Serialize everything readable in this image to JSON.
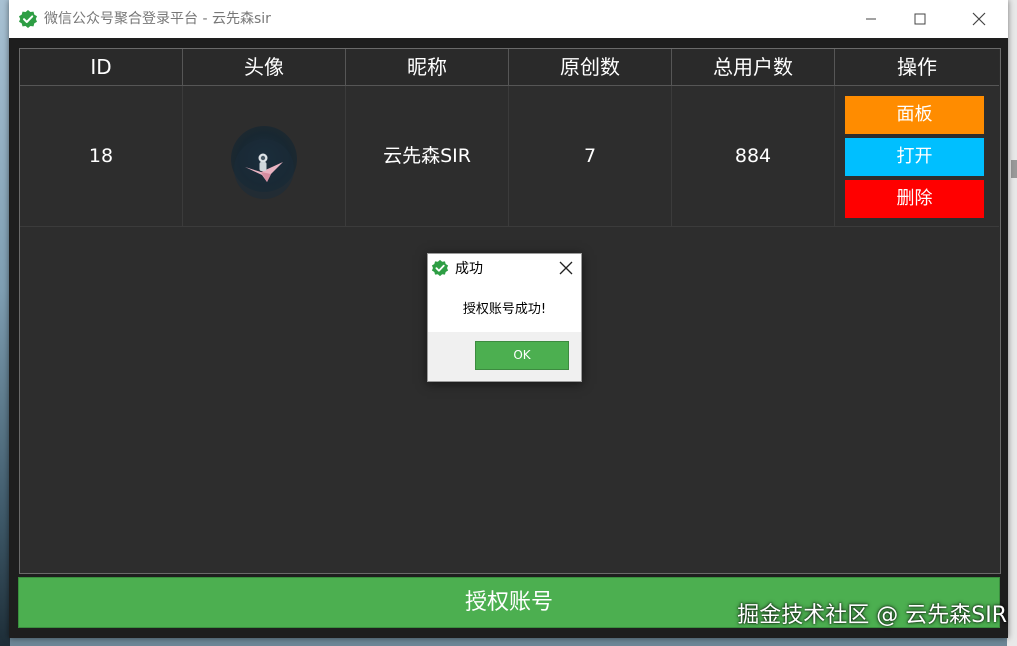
{
  "window": {
    "title": "微信公众号聚合登录平台 - 云先森sir",
    "icon": "green-checkmark-shield-icon"
  },
  "table": {
    "headers": [
      "ID",
      "头像",
      "昵称",
      "原创数",
      "总用户数",
      "操作"
    ],
    "rows": [
      {
        "id": "18",
        "avatar": "astronaut-on-paper-crane-avatar",
        "nickname": "云先森SIR",
        "original_count": "7",
        "total_users": "884"
      }
    ],
    "actions": {
      "panel": "面板",
      "open": "打开",
      "delete": "删除"
    }
  },
  "authorize_button": "授权账号",
  "dialog": {
    "title": "成功",
    "message": "授权账号成功!",
    "ok": "OK"
  },
  "watermark": "掘金技术社区 @ 云先森SIR",
  "colors": {
    "accent_green": "#4caf50",
    "panel_orange": "#ff8c00",
    "open_blue": "#00bfff",
    "delete_red": "#ff0000",
    "table_bg": "#2d2d2d"
  }
}
